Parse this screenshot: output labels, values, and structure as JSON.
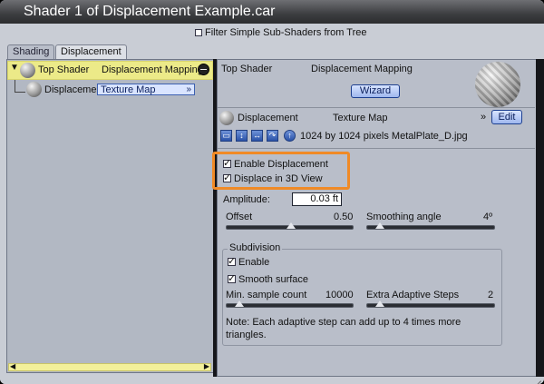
{
  "window": {
    "title": "Shader 1 of Displacement Example.car"
  },
  "filter": {
    "label": "Filter Simple Sub-Shaders from Tree",
    "checked": false
  },
  "tabs": [
    {
      "label": "Shading",
      "active": false
    },
    {
      "label": "Displacement",
      "active": true
    }
  ],
  "tree": {
    "root": {
      "name": "Top Shader",
      "type": "Displacement Mapping"
    },
    "child": {
      "name": "Displaceme",
      "value": "Texture Map",
      "dropdown_arrow": "»"
    }
  },
  "header": {
    "name": "Top Shader",
    "type": "Displacement Mapping",
    "wizard_label": "Wizard"
  },
  "texture": {
    "name": "Displacement",
    "type": "Texture Map",
    "collapse_glyph": "»",
    "edit_label": "Edit",
    "file_info": "1024 by 1024 pixels MetalPlate_D.jpg"
  },
  "options": {
    "enable_displacement": {
      "label": "Enable Displacement",
      "checked": true
    },
    "displace_3d": {
      "label": "Displace in 3D View",
      "checked": true
    }
  },
  "amplitude": {
    "label": "Amplitude:",
    "value": "0.03 ft"
  },
  "offset": {
    "label": "Offset",
    "value": "0.50",
    "fraction": 0.5
  },
  "smoothing": {
    "label": "Smoothing angle",
    "value": "4º",
    "fraction": 0.04
  },
  "subdivision": {
    "title": "Subdivision",
    "enable": {
      "label": "Enable",
      "checked": true
    },
    "smooth": {
      "label": "Smooth surface",
      "checked": true
    },
    "min_sample": {
      "label": "Min. sample count",
      "value": "10000",
      "fraction": 0.08
    },
    "extra_steps": {
      "label": "Extra Adaptive Steps",
      "value": "2",
      "fraction": 0.08
    },
    "note": "Note: Each adaptive step can add up to 4 times more triangles."
  },
  "colors": {
    "highlight": "#f08a26",
    "selection": "#ecea88",
    "accent": "#1d3f8f"
  }
}
